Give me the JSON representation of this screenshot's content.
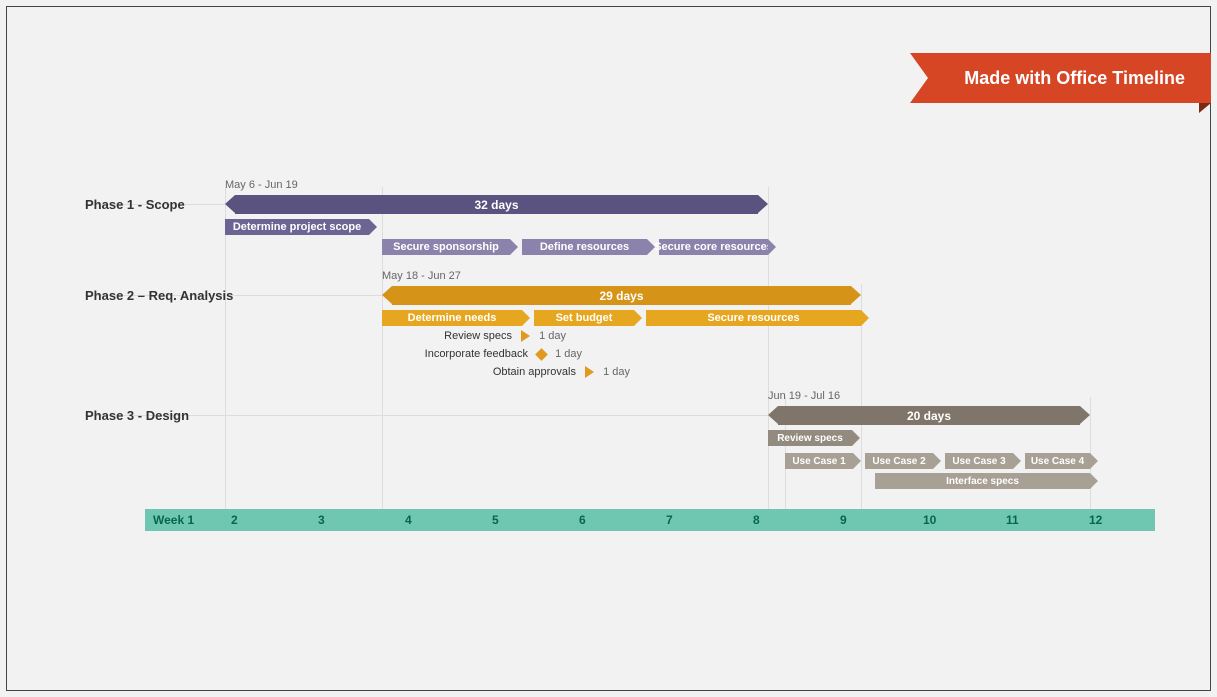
{
  "ribbon": "Made with Office Timeline",
  "labels": {
    "phase1": "Phase 1 - Scope",
    "phase2": "Phase 2 – Req. Analysis",
    "phase3": "Phase 3 - Design"
  },
  "phase1": {
    "range": "May 6 - Jun 19",
    "main": "32 days",
    "t1": "Determine project scope",
    "t2": "Secure sponsorship",
    "t3": "Define resources",
    "t4": "Secure core resources"
  },
  "phase2": {
    "range": "May 18 - Jun 27",
    "main": "29 days",
    "t1": "Determine needs",
    "t2": "Set budget",
    "t3": "Secure resources",
    "m1": {
      "label": "Review specs",
      "dur": "1 day"
    },
    "m2": {
      "label": "Incorporate feedback",
      "dur": "1 day"
    },
    "m3": {
      "label": "Obtain approvals",
      "dur": "1 day"
    }
  },
  "phase3": {
    "range": "Jun 19 - Jul 16",
    "main": "20 days",
    "t1": "Review specs",
    "u1": "Use Case 1",
    "u2": "Use Case 2",
    "u3": "Use Case 3",
    "u4": "Use Case 4",
    "is": "Interface specs"
  },
  "axis": {
    "w1": "Week 1",
    "w2": "2",
    "w3": "3",
    "w4": "4",
    "w5": "5",
    "w6": "6",
    "w7": "7",
    "w8": "8",
    "w9": "9",
    "w10": "10",
    "w11": "11",
    "w12": "12"
  }
}
